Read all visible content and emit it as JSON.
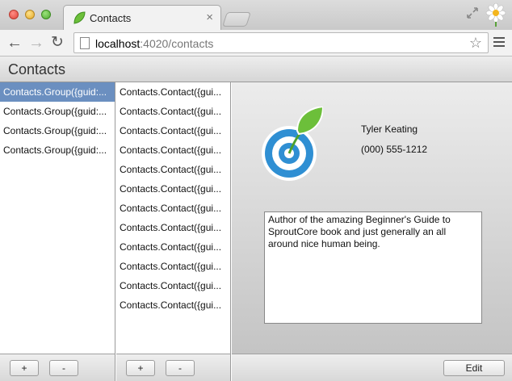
{
  "browser": {
    "tab_title": "Contacts",
    "tab_close": "×",
    "url_host": "localhost",
    "url_rest": ":4020/contacts",
    "back": "←",
    "forward": "→",
    "reload": "↻",
    "bookmark_star": "☆"
  },
  "app": {
    "title": "Contacts"
  },
  "groups": {
    "items": [
      {
        "label": "Contacts.Group({guid:..."
      },
      {
        "label": "Contacts.Group({guid:..."
      },
      {
        "label": "Contacts.Group({guid:..."
      },
      {
        "label": "Contacts.Group({guid:..."
      }
    ],
    "selected_index": 0,
    "add_label": "+",
    "remove_label": "-"
  },
  "contacts": {
    "items": [
      {
        "label": "Contacts.Contact({gui..."
      },
      {
        "label": "Contacts.Contact({gui..."
      },
      {
        "label": "Contacts.Contact({gui..."
      },
      {
        "label": "Contacts.Contact({gui..."
      },
      {
        "label": "Contacts.Contact({gui..."
      },
      {
        "label": "Contacts.Contact({gui..."
      },
      {
        "label": "Contacts.Contact({gui..."
      },
      {
        "label": "Contacts.Contact({gui..."
      },
      {
        "label": "Contacts.Contact({gui..."
      },
      {
        "label": "Contacts.Contact({gui..."
      },
      {
        "label": "Contacts.Contact({gui..."
      },
      {
        "label": "Contacts.Contact({gui..."
      }
    ],
    "add_label": "+",
    "remove_label": "-"
  },
  "detail": {
    "name": "Tyler Keating",
    "phone": "(000) 555-1212",
    "bio": "Author of the amazing Beginner's Guide to SproutCore book and just generally an all around nice human being.",
    "edit_label": "Edit"
  },
  "colors": {
    "selection": "#6b8fc0",
    "logo_blue": "#2f8fd3",
    "logo_green": "#6cbf3a"
  }
}
